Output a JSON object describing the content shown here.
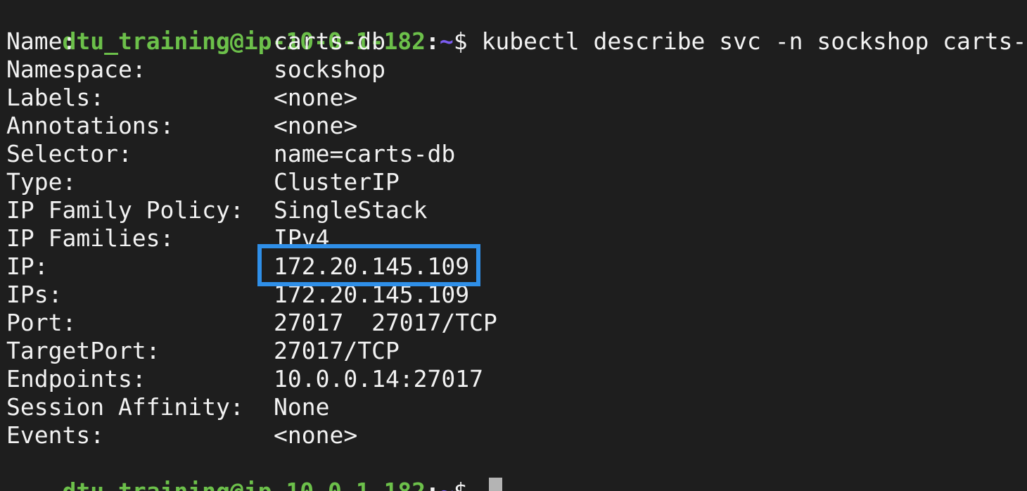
{
  "prompt": {
    "user_host": "dtu_training@ip-10-0-1-182",
    "colon": ":",
    "tilde": "~",
    "dollar": "$ "
  },
  "command": "kubectl describe svc -n sockshop carts-db",
  "fields": [
    {
      "key": "Name:",
      "value": "carts-db"
    },
    {
      "key": "Namespace:",
      "value": "sockshop"
    },
    {
      "key": "Labels:",
      "value": "<none>"
    },
    {
      "key": "Annotations:",
      "value": "<none>"
    },
    {
      "key": "Selector:",
      "value": "name=carts-db"
    },
    {
      "key": "Type:",
      "value": "ClusterIP"
    },
    {
      "key": "IP Family Policy:",
      "value": "SingleStack"
    },
    {
      "key": "IP Families:",
      "value": "IPv4"
    },
    {
      "key": "IP:",
      "value": "172.20.145.109"
    },
    {
      "key": "IPs:",
      "value": "172.20.145.109"
    },
    {
      "key": "Port:",
      "value": "27017  27017/TCP"
    },
    {
      "key": "TargetPort:",
      "value": "27017/TCP"
    },
    {
      "key": "Endpoints:",
      "value": "10.0.0.14:27017"
    },
    {
      "key": "Session Affinity:",
      "value": "None"
    },
    {
      "key": "Events:",
      "value": "<none>"
    }
  ],
  "colors": {
    "background": "#1e1e1e",
    "prompt_user": "#6cc04a",
    "prompt_tilde": "#7b5cf0",
    "highlight_box": "#2f8fe8",
    "text": "#f2f2f2"
  }
}
